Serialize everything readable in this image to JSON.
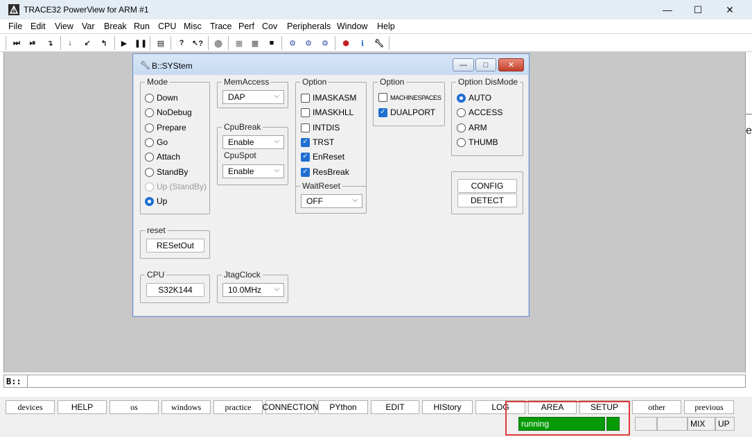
{
  "window": {
    "title": "TRACE32 PowerView for ARM #1",
    "min_glyph": "—",
    "max_glyph": "☐",
    "close_glyph": "✕"
  },
  "menu": [
    "File",
    "Edit",
    "View",
    "Var",
    "Break",
    "Run",
    "CPU",
    "Misc",
    "Trace",
    "Perf",
    "Cov",
    "Peripherals",
    "Window",
    "Help"
  ],
  "toolbar_icons": [
    "step-icon",
    "step-over-icon",
    "step-into-icon",
    "down-arrow-icon",
    "return-icon",
    "up-level-icon",
    "go-icon",
    "break-icon",
    "list-icon",
    "help-icon",
    "help-context-icon",
    "stop-circle-icon",
    "grid-icon",
    "grid2-icon",
    "memory-icon",
    "cpu-icon",
    "cpu2-icon",
    "cpu3-icon",
    "bug-icon",
    "info-icon",
    "wrench-icon"
  ],
  "dialog": {
    "title": "B::SYStem",
    "mode": {
      "title": "Mode",
      "options": [
        {
          "label": "Down",
          "selected": false,
          "disabled": false
        },
        {
          "label": "NoDebug",
          "selected": false,
          "disabled": false
        },
        {
          "label": "Prepare",
          "selected": false,
          "disabled": false
        },
        {
          "label": "Go",
          "selected": false,
          "disabled": false
        },
        {
          "label": "Attach",
          "selected": false,
          "disabled": false
        },
        {
          "label": "StandBy",
          "selected": false,
          "disabled": false
        },
        {
          "label": "Up (StandBy)",
          "selected": false,
          "disabled": true
        },
        {
          "label": "Up",
          "selected": true,
          "disabled": false
        }
      ]
    },
    "memaccess": {
      "title": "MemAccess",
      "value": "DAP"
    },
    "cpubreak": {
      "title": "CpuBreak",
      "value": "Enable"
    },
    "cpuspot": {
      "title": "CpuSpot",
      "value": "Enable"
    },
    "option1": {
      "title": "Option",
      "items": [
        {
          "label": "IMASKASM",
          "checked": false
        },
        {
          "label": "IMASKHLL",
          "checked": false
        },
        {
          "label": "INTDIS",
          "checked": false
        },
        {
          "label": "TRST",
          "checked": true
        },
        {
          "label": "EnReset",
          "checked": true
        },
        {
          "label": "ResBreak",
          "checked": true
        }
      ]
    },
    "waitreset": {
      "title": "WaitReset",
      "value": "OFF"
    },
    "option2": {
      "title": "Option",
      "items": [
        {
          "label": "MACHINESPACES",
          "checked": false
        },
        {
          "label": "DUALPORT",
          "checked": true
        }
      ]
    },
    "dismode": {
      "title": "Option DisMode",
      "options": [
        {
          "label": "AUTO",
          "selected": true
        },
        {
          "label": "ACCESS",
          "selected": false
        },
        {
          "label": "ARM",
          "selected": false
        },
        {
          "label": "THUMB",
          "selected": false
        }
      ]
    },
    "config_label": "CONFIG",
    "detect_label": "DETECT",
    "reset": {
      "title": "reset",
      "button": "RESetOut"
    },
    "cpu": {
      "title": "CPU",
      "value": "S32K144"
    },
    "jtagclock": {
      "title": "JtagClock",
      "value": "10.0MHz"
    },
    "title_btn_min": "—",
    "title_btn_max": "□",
    "title_btn_close": "✕"
  },
  "edge_char": "e",
  "command": {
    "prompt": "B::"
  },
  "softkeys": [
    "devices",
    "HELP",
    "os",
    "windows",
    "practice",
    "CONNECTION",
    "PYthon",
    "EDIT",
    "HIStory",
    "LOG",
    "AREA",
    "SETUP",
    "other",
    "previous"
  ],
  "status": {
    "state": "running",
    "mix": "MIX",
    "up": "UP",
    "running_color": "#069b06"
  },
  "highlight_color": "#e03a3a"
}
